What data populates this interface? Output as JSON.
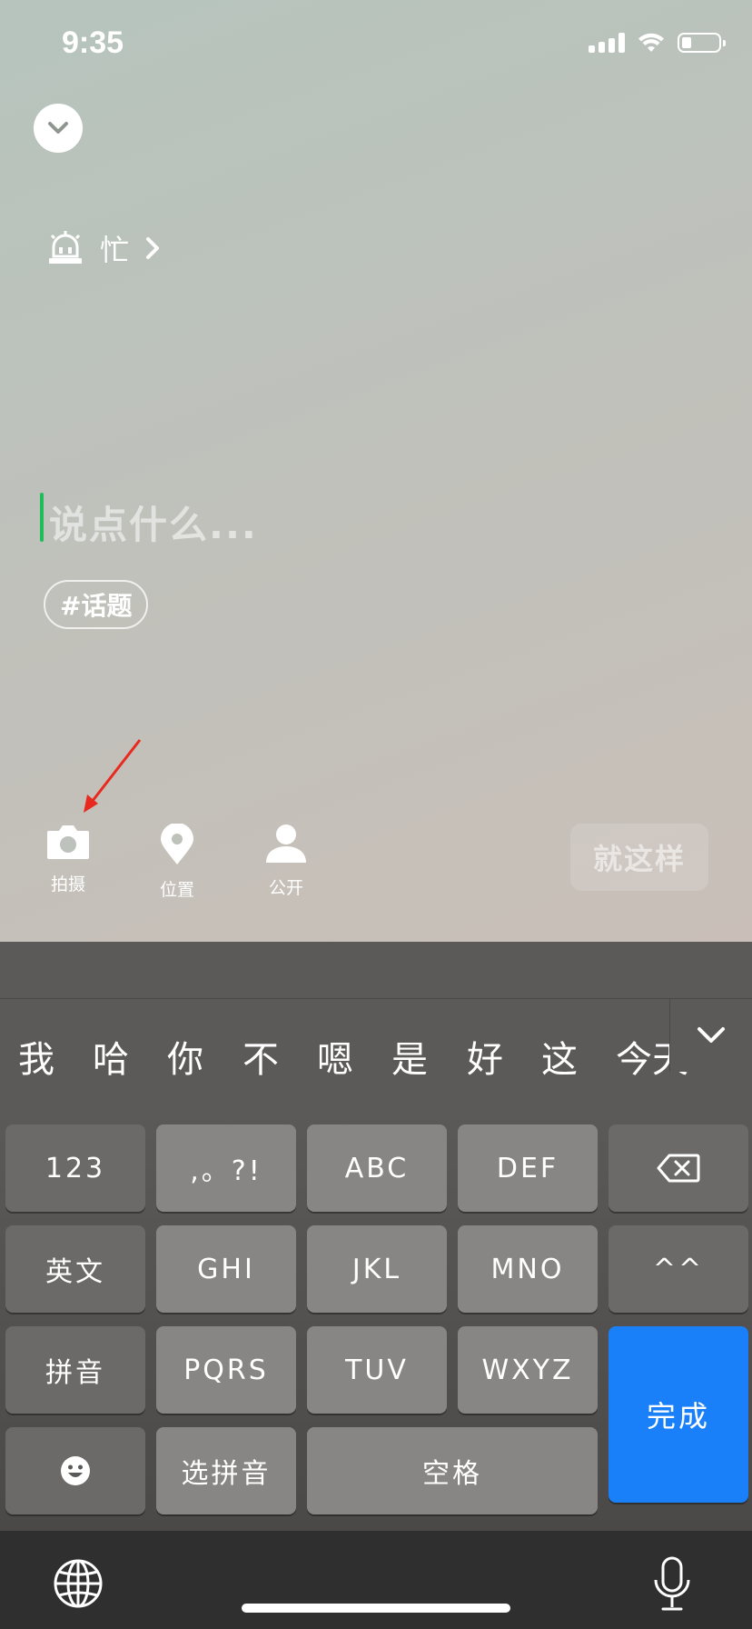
{
  "status_bar": {
    "time": "9:35"
  },
  "mood": {
    "label": "忙"
  },
  "composer": {
    "placeholder": "说点什么...",
    "topic_chip": "#话题",
    "cursor_color": "#1fbd5a"
  },
  "tools": [
    {
      "label": "拍摄",
      "icon": "camera-icon"
    },
    {
      "label": "位置",
      "icon": "location-pin-icon"
    },
    {
      "label": "公开",
      "icon": "person-icon"
    }
  ],
  "submit": {
    "label": "就这样"
  },
  "keyboard": {
    "candidates": [
      "我",
      "哈",
      "你",
      "不",
      "嗯",
      "是",
      "好",
      "这",
      "今天"
    ],
    "rows": [
      [
        "123",
        ",。?!",
        "ABC",
        "DEF",
        "delete-icon"
      ],
      [
        "英文",
        "GHI",
        "JKL",
        "MNO",
        "^^"
      ],
      [
        "拼音",
        "PQRS",
        "TUV",
        "WXYZ"
      ],
      [
        "emoji-icon",
        "选拼音",
        "空格"
      ]
    ],
    "key_123": "123",
    "key_punct": ",。?!",
    "key_abc": "ABC",
    "key_def": "DEF",
    "key_english": "英文",
    "key_ghi": "GHI",
    "key_jkl": "JKL",
    "key_mno": "MNO",
    "key_kaomoji": "^^",
    "key_pinyin": "拼音",
    "key_pqrs": "PQRS",
    "key_tuv": "TUV",
    "key_wxyz": "WXYZ",
    "key_select_pinyin": "选拼音",
    "key_space": "空格",
    "key_done": "完成",
    "done_color": "#1a80fa"
  }
}
